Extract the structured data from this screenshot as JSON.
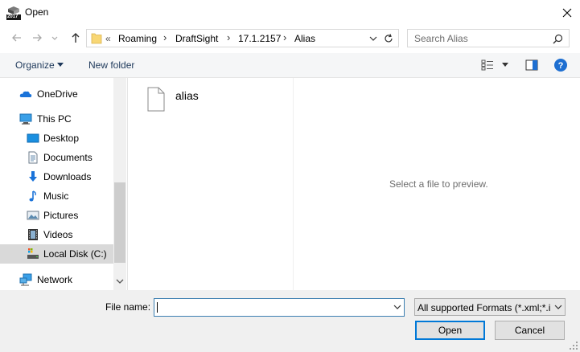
{
  "window": {
    "title": "Open",
    "app_icon_badge": "2017"
  },
  "address": {
    "overflow": "«",
    "crumbs": [
      "Roaming",
      "DraftSight",
      "17.1.2157",
      "Alias"
    ],
    "separator": "›"
  },
  "search": {
    "placeholder": "Search Alias"
  },
  "toolbar": {
    "organize": "Organize",
    "new_folder": "New folder"
  },
  "nav": {
    "items": [
      {
        "label": "OneDrive",
        "icon": "cloud-icon"
      },
      {
        "label": "This PC",
        "icon": "computer-icon"
      },
      {
        "label": "Desktop",
        "icon": "desktop-icon"
      },
      {
        "label": "Documents",
        "icon": "documents-icon"
      },
      {
        "label": "Downloads",
        "icon": "download-arrow-icon"
      },
      {
        "label": "Music",
        "icon": "music-note-icon"
      },
      {
        "label": "Pictures",
        "icon": "pictures-icon"
      },
      {
        "label": "Videos",
        "icon": "film-icon"
      },
      {
        "label": "Local Disk (C:)",
        "icon": "drive-icon",
        "selected": true
      },
      {
        "label": "Network",
        "icon": "network-icon"
      }
    ]
  },
  "files": [
    {
      "name": "alias",
      "icon": "blank-file-icon"
    }
  ],
  "preview": {
    "message": "Select a file to preview."
  },
  "bottom": {
    "filename_label": "File name:",
    "filename_value": "",
    "filter": "All supported Formats (*.xml;*.i",
    "open_button": "Open",
    "cancel_button": "Cancel"
  },
  "colors": {
    "accent": "#0078d7",
    "link": "#1e395b",
    "help": "#1e6fd1",
    "selection": "#d9d9d9"
  }
}
